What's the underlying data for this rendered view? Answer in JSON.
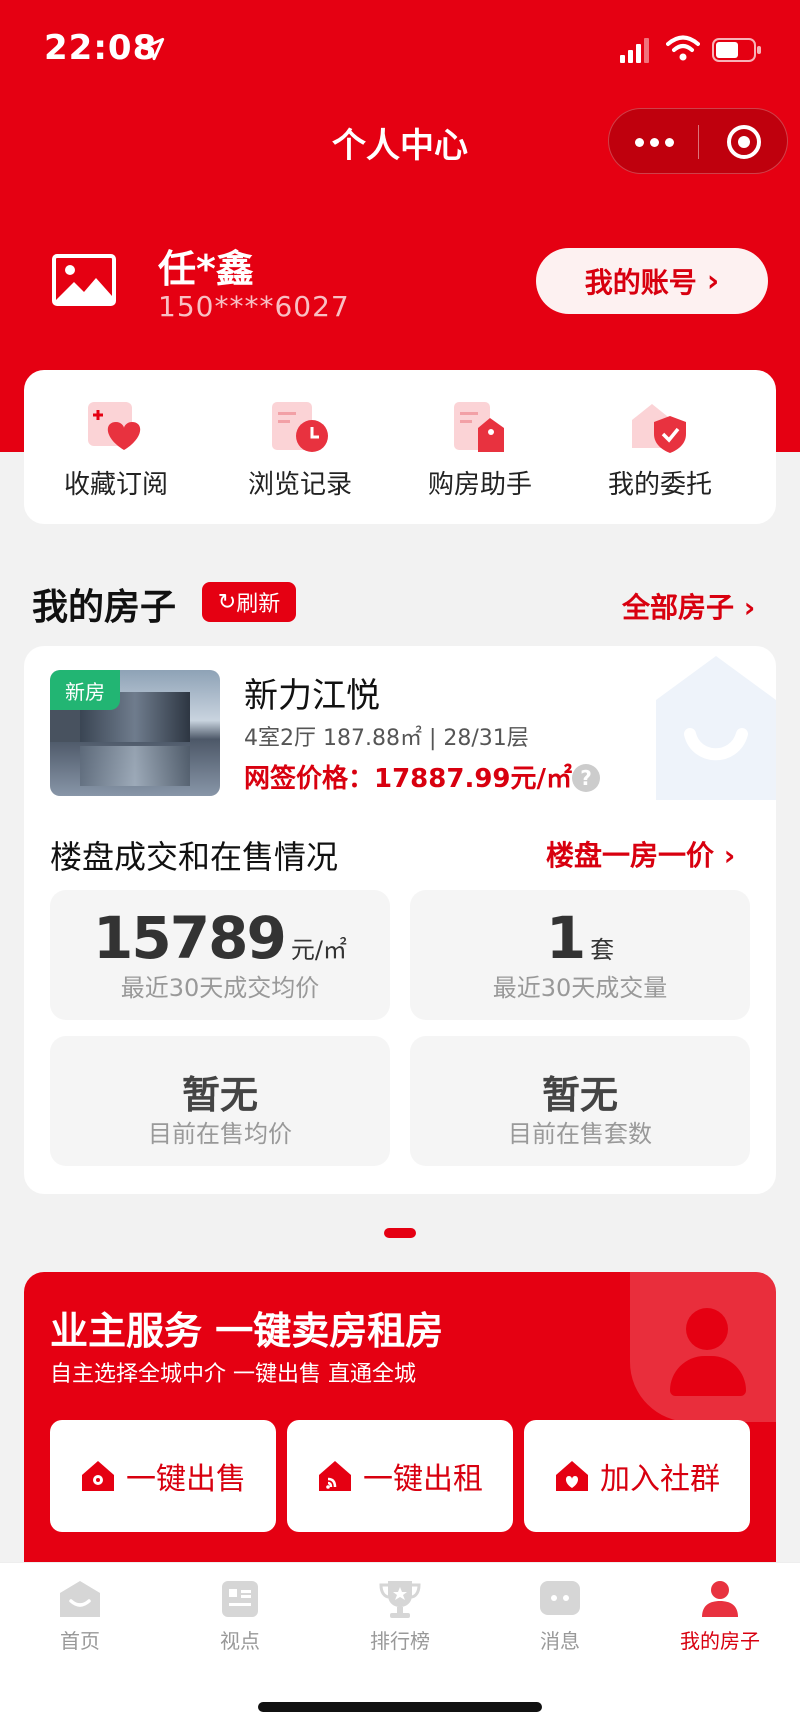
{
  "status_bar": {
    "time": "22:08"
  },
  "nav": {
    "title": "个人中心"
  },
  "profile": {
    "name": "任*鑫",
    "phone": "150****6027",
    "account_button": "我的账号"
  },
  "quick_actions": [
    {
      "label": "收藏订阅",
      "icon": "favorite-heart-icon"
    },
    {
      "label": "浏览记录",
      "icon": "history-clock-icon"
    },
    {
      "label": "购房助手",
      "icon": "purchase-assistant-icon"
    },
    {
      "label": "我的委托",
      "icon": "entrust-shield-icon"
    }
  ],
  "my_house": {
    "title": "我的房子",
    "refresh_label": "刷新",
    "all_link": "全部房子",
    "house": {
      "badge": "新房",
      "name": "新力江悦",
      "info": "4室2厅 187.88㎡ | 28/31层",
      "price": "网签价格：17887.99元/㎡",
      "help": "?"
    },
    "deal_title": "楼盘成交和在售情况",
    "price_link": "楼盘一房一价",
    "stats": [
      {
        "value": "15789",
        "unit": "元/㎡",
        "label": "最近30天成交均价"
      },
      {
        "value": "1",
        "unit": "套",
        "label": "最近30天成交量"
      },
      {
        "value": "暂无",
        "label": "目前在售均价"
      },
      {
        "value": "暂无",
        "label": "目前在售套数"
      }
    ]
  },
  "owner_service": {
    "title": "业主服务 一键卖房租房",
    "subtitle": "自主选择全城中介 一键出售 直通全城",
    "buttons": [
      {
        "label": "一键出售",
        "icon": "house-gear-icon"
      },
      {
        "label": "一键出租",
        "icon": "house-signal-icon"
      },
      {
        "label": "加入社群",
        "icon": "house-heart-icon"
      }
    ]
  },
  "tabbar": [
    {
      "label": "首页",
      "icon": "home-icon",
      "active": false
    },
    {
      "label": "视点",
      "icon": "viewpoint-icon",
      "active": false
    },
    {
      "label": "排行榜",
      "icon": "trophy-icon",
      "active": false
    },
    {
      "label": "消息",
      "icon": "message-icon",
      "active": false
    },
    {
      "label": "我的房子",
      "icon": "my-house-person-icon",
      "active": true
    }
  ],
  "colors": {
    "brand_red": "#e50012",
    "badge_green": "#22b573"
  }
}
